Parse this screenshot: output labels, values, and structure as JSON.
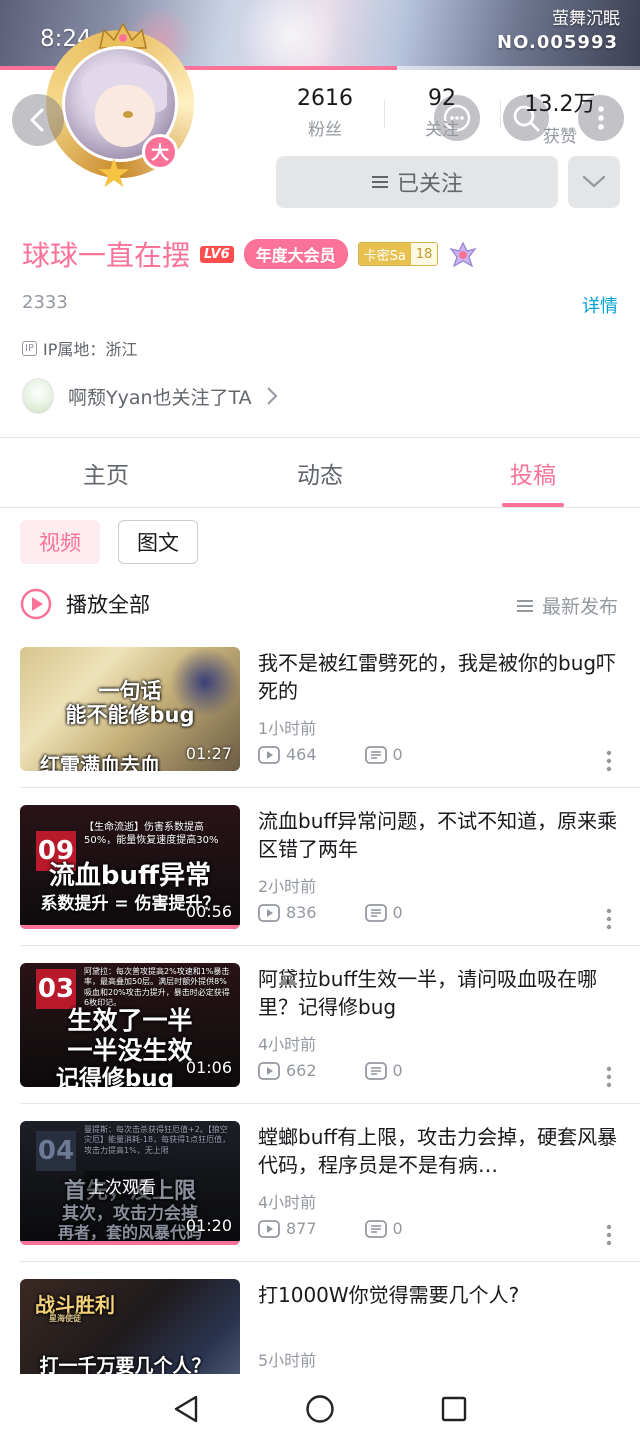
{
  "status_bar": {
    "time": "8:24"
  },
  "banner": {
    "title": "萤舞沉眠",
    "number": "NO.005993",
    "progress": 0.62
  },
  "profile": {
    "vip_badge": "大",
    "stats": [
      {
        "value": "2616",
        "label": "粉丝"
      },
      {
        "value": "92",
        "label": "关注"
      },
      {
        "value": "13.2万",
        "label": "获赞"
      }
    ],
    "follow_button": "已关注",
    "username": "球球一直在摆",
    "level": "LV6",
    "vip_tag": "年度大会员",
    "medal": {
      "name": "卡密Sa",
      "level": "18"
    },
    "sign": "2333",
    "detail_link": "详情",
    "ip_icon": "IP",
    "ip_location": "IP属地：浙江",
    "mutual_follow": "啊颓Yyan也关注了TA"
  },
  "tabs": [
    {
      "label": "主页"
    },
    {
      "label": "动态"
    },
    {
      "label": "投稿"
    }
  ],
  "sub_tabs": [
    {
      "label": "视频"
    },
    {
      "label": "图文"
    }
  ],
  "play_all": "播放全部",
  "sort": "最新发布",
  "videos": [
    {
      "title": "我不是被红雷劈死的，我是被你的bug吓死的",
      "time": "1小时前",
      "views": "464",
      "comments": "0",
      "duration": "01:27",
      "thumb_lines": [
        "一句话",
        "能不能修bug",
        "红雷满血去血"
      ]
    },
    {
      "title": "流血buff异常问题，不试不知道，原来乘区错了两年",
      "time": "2小时前",
      "views": "836",
      "comments": "0",
      "duration": "00:56",
      "thumb_number": "09",
      "thumb_small": "【生命流逝】伤害系数提高50%，能量恢复速度提高30%",
      "thumb_lines": [
        "流血buff异常",
        "系数提升 = 伤害提升？"
      ]
    },
    {
      "title": "阿黛拉buff生效一半，请问吸血吸在哪里？记得修bug",
      "time": "4小时前",
      "views": "662",
      "comments": "0",
      "duration": "01:06",
      "thumb_number": "03",
      "thumb_small": "阿黛拉：每次普攻提高2%攻速和1%暴击率，最高叠加50层。满层时额外提供8%吸血和20%攻击力提升，暴击时必定获得6枚印记。",
      "thumb_lines": [
        "生效了一半",
        "一半没生效",
        "记得修bug"
      ]
    },
    {
      "title": "螳螂buff有上限，攻击力会掉，硬套风暴代码，程序员是不是有病…",
      "time": "4小时前",
      "views": "877",
      "comments": "0",
      "duration": "01:20",
      "thumb_number": "04",
      "thumb_small": "曼提斯：每次击杀获得狂厄值+2。【狼空灾厄】能量消耗-18，每获得1点狂厄值，攻击力提高1%，无上限",
      "thumb_lines": [
        "首先，没上限",
        "其次，攻击力会掉",
        "再者，套的风暴代码"
      ],
      "last_watched": "上次观看"
    },
    {
      "title": "打1000W你觉得需要几个人?",
      "time": "5小时前",
      "thumb_lines": [
        "战斗胜利",
        "星海使徒",
        "打一千万要几个人？"
      ]
    }
  ]
}
